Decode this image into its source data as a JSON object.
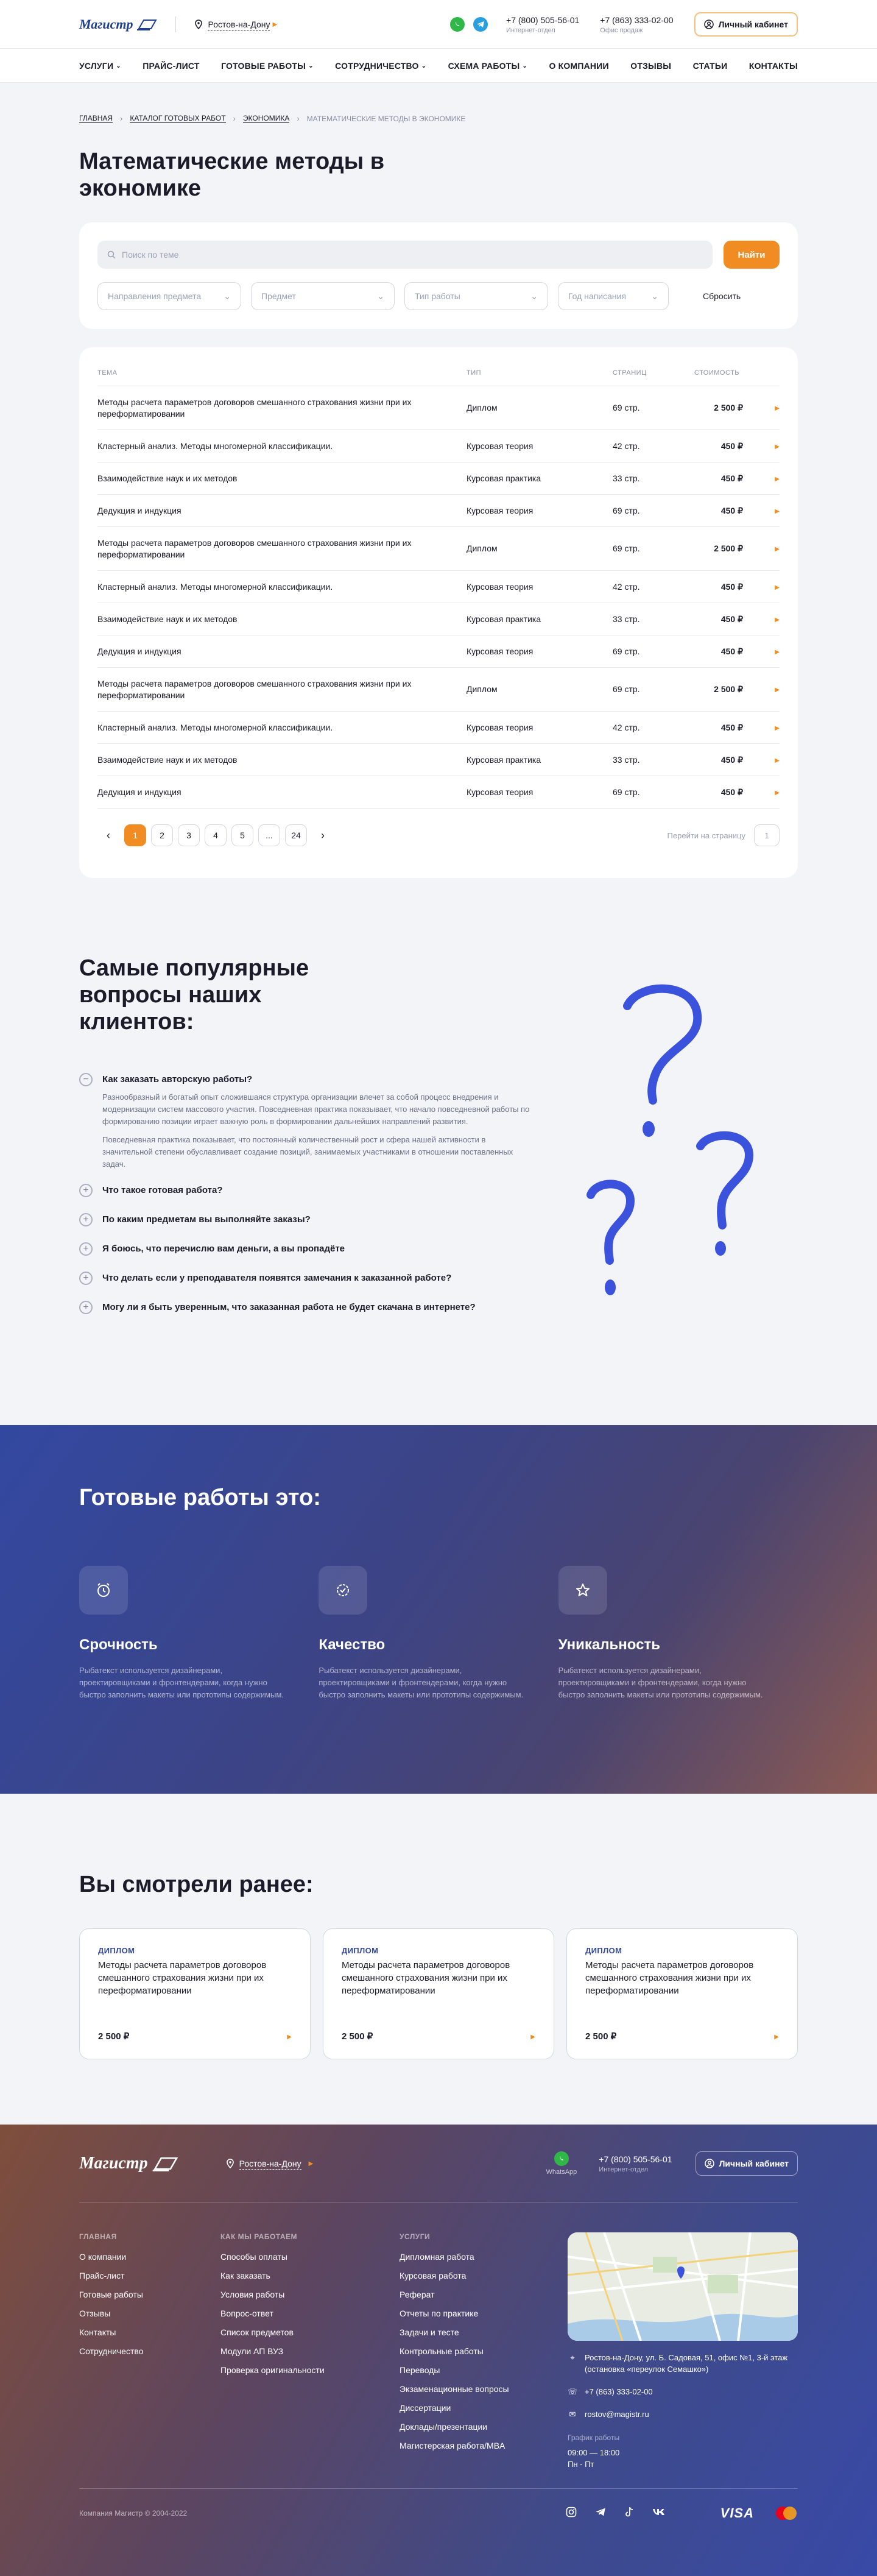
{
  "header": {
    "logo_text": "Магистр",
    "city": "Ростов-на-Дону",
    "phones": [
      {
        "number": "+7 (800) 505-56-01",
        "label": "Интернет-отдел"
      },
      {
        "number": "+7 (863) 333-02-00",
        "label": "Офис продаж"
      }
    ],
    "cabinet_label": "Личный кабинет"
  },
  "nav": [
    {
      "label": "УСЛУГИ",
      "dropdown": true
    },
    {
      "label": "ПРАЙС-ЛИСТ",
      "dropdown": false
    },
    {
      "label": "ГОТОВЫЕ РАБОТЫ",
      "dropdown": true
    },
    {
      "label": "СОТРУДНИЧЕСТВО",
      "dropdown": true
    },
    {
      "label": "СХЕМА РАБОТЫ",
      "dropdown": true
    },
    {
      "label": "О КОМПАНИИ",
      "dropdown": false
    },
    {
      "label": "ОТЗЫВЫ",
      "dropdown": false
    },
    {
      "label": "СТАТЬИ",
      "dropdown": false
    },
    {
      "label": "КОНТАКТЫ",
      "dropdown": false
    }
  ],
  "breadcrumb": [
    "ГЛАВНАЯ",
    "КАТАЛОГ ГОТОВЫХ РАБОТ",
    "ЭКОНОМИКА",
    "МАТЕМАТИЧЕСКИЕ МЕТОДЫ В ЭКОНОМИКЕ"
  ],
  "page_title": "Математические методы в экономике",
  "search": {
    "placeholder": "Поиск по теме",
    "button": "Найти",
    "filters": [
      {
        "placeholder": "Направления предмета",
        "width": 0
      },
      {
        "placeholder": "Предмет"
      },
      {
        "placeholder": "Тип работы"
      },
      {
        "placeholder": "Год написания"
      }
    ],
    "reset": "Сбросить"
  },
  "table": {
    "headers": [
      "ТЕМА",
      "ТИП",
      "СТРАНИЦ",
      "СТОИМОСТЬ"
    ],
    "rows": [
      {
        "title": "Методы расчета параметров договоров смешанного страхования жизни при их переформатировании",
        "type": "Диплом",
        "pages": "69 стр.",
        "price": "2 500 ₽"
      },
      {
        "title": "Кластерный анализ. Методы многомерной классификации.",
        "type": "Курсовая теория",
        "pages": "42 стр.",
        "price": "450 ₽"
      },
      {
        "title": "Взаимодействие наук и их методов",
        "type": "Курсовая практика",
        "pages": "33 стр.",
        "price": "450 ₽"
      },
      {
        "title": "Дедукция и индукция",
        "type": "Курсовая теория",
        "pages": "69 стр.",
        "price": "450 ₽"
      },
      {
        "title": "Методы расчета параметров договоров смешанного страхования жизни при их переформатировании",
        "type": "Диплом",
        "pages": "69 стр.",
        "price": "2 500 ₽"
      },
      {
        "title": "Кластерный анализ. Методы многомерной классификации.",
        "type": "Курсовая теория",
        "pages": "42 стр.",
        "price": "450 ₽"
      },
      {
        "title": "Взаимодействие наук и их методов",
        "type": "Курсовая практика",
        "pages": "33 стр.",
        "price": "450 ₽"
      },
      {
        "title": "Дедукция и индукция",
        "type": "Курсовая теория",
        "pages": "69 стр.",
        "price": "450 ₽"
      },
      {
        "title": "Методы расчета параметров договоров смешанного страхования жизни при их переформатировании",
        "type": "Диплом",
        "pages": "69 стр.",
        "price": "2 500 ₽"
      },
      {
        "title": "Кластерный анализ. Методы многомерной классификации.",
        "type": "Курсовая теория",
        "pages": "42 стр.",
        "price": "450 ₽"
      },
      {
        "title": "Взаимодействие наук и их методов",
        "type": "Курсовая практика",
        "pages": "33 стр.",
        "price": "450 ₽"
      },
      {
        "title": "Дедукция и индукция",
        "type": "Курсовая теория",
        "pages": "69 стр.",
        "price": "450 ₽"
      }
    ]
  },
  "pagination": {
    "pages": [
      "1",
      "2",
      "3",
      "4",
      "5",
      "...",
      "24"
    ],
    "current": "1",
    "goto_label": "Перейти на страницу",
    "goto_value": "1"
  },
  "faq": {
    "title": "Самые популярные вопросы наших клиентов:",
    "items": [
      {
        "q": "Как заказать авторскую работы?",
        "open": true,
        "a": [
          "Разнообразный и богатый опыт сложившаяся структура организации влечет за собой процесс внедрения и модернизации систем массового участия. Повседневная практика показывает, что начало повседневной работы по формированию позиции играет важную роль в формировании дальнейших направлений развития.",
          "Повседневная практика показывает, что постоянный количественный рост и сфера нашей активности в значительной степени обуславливает создание позиций, занимаемых участниками в отношении поставленных задач."
        ]
      },
      {
        "q": "Что такое готовая работа?",
        "open": false
      },
      {
        "q": "По каким предметам вы выполняйте заказы?",
        "open": false
      },
      {
        "q": "Я боюсь, что перечислю вам деньги, а вы пропадёте",
        "open": false
      },
      {
        "q": "Что делать если у преподавателя появятся замечания к заказанной работе?",
        "open": false
      },
      {
        "q": "Могу ли я быть уверенным, что заказанная работа не будет скачана в интернете?",
        "open": false
      }
    ]
  },
  "ready": {
    "title": "Готовые работы это:",
    "features": [
      {
        "icon": "alarm-clock-icon",
        "title": "Срочность",
        "text": "Рыбатекст используется дизайнерами, проектировщиками и фронтендерами, когда нужно быстро заполнить макеты или прототипы содержимым."
      },
      {
        "icon": "quality-badge-icon",
        "title": "Качество",
        "text": "Рыбатекст используется дизайнерами, проектировщиками и фронтендерами, когда нужно быстро заполнить макеты или прототипы содержимым."
      },
      {
        "icon": "star-icon",
        "title": "Уникальность",
        "text": "Рыбатекст используется дизайнерами, проектировщиками и фронтендерами, когда нужно быстро заполнить макеты или прототипы содержимым."
      }
    ]
  },
  "viewed": {
    "title": "Вы смотрели ранее:",
    "cards": [
      {
        "type": "ДИПЛОМ",
        "title": "Методы расчета параметров договоров смешанного страхования жизни при их переформатировании",
        "price": "2 500 ₽"
      },
      {
        "type": "ДИПЛОМ",
        "title": "Методы расчета параметров договоров смешанного страхования жизни при их переформатировании",
        "price": "2 500 ₽"
      },
      {
        "type": "ДИПЛОМ",
        "title": "Методы расчета параметров договоров смешанного страхования жизни при их переформатировании",
        "price": "2 500 ₽"
      }
    ]
  },
  "footer": {
    "logo_text": "Магистр",
    "city": "Ростов-на-Дону",
    "whatsapp_label": "WhatsApp",
    "phone": {
      "number": "+7 (800) 505-56-01",
      "label": "Интернет-отдел"
    },
    "cabinet_label": "Личный кабинет",
    "columns": [
      {
        "title": "ГЛАВНАЯ",
        "links": [
          "О компании",
          "Прайс-лист",
          "Готовые работы",
          "Отзывы",
          "Контакты",
          "Сотрудничество"
        ]
      },
      {
        "title": "КАК МЫ РАБОТАЕМ",
        "links": [
          "Способы оплаты",
          "Как заказать",
          "Условия работы",
          "Вопрос-ответ",
          "Список предметов",
          "Модули АП ВУЗ",
          "Проверка оригинальности"
        ]
      },
      {
        "title": "УСЛУГИ",
        "links": [
          "Дипломная работа",
          "Курсовая работа",
          "Реферат",
          "Отчеты по практике",
          "Задачи и тесте",
          "Контрольные работы",
          "Переводы",
          "Экзаменационные вопросы",
          "Диссертации",
          "Доклады/презентации",
          "Магистерская работа/MBA"
        ]
      }
    ],
    "address": "Ростов-на-Дону, ул. Б. Садовая, 51, офис №1, 3-й этаж (остановка «переулок Семашко»)",
    "contact_phone": "+7 (863) 333-02-00",
    "email": "rostov@magistr.ru",
    "schedule_label": "График работы",
    "schedule": [
      "09:00 — 18:00",
      "Пн - Пт"
    ],
    "copyright": "Компания Магистр © 2004-2022",
    "payment": [
      "VISA"
    ]
  }
}
